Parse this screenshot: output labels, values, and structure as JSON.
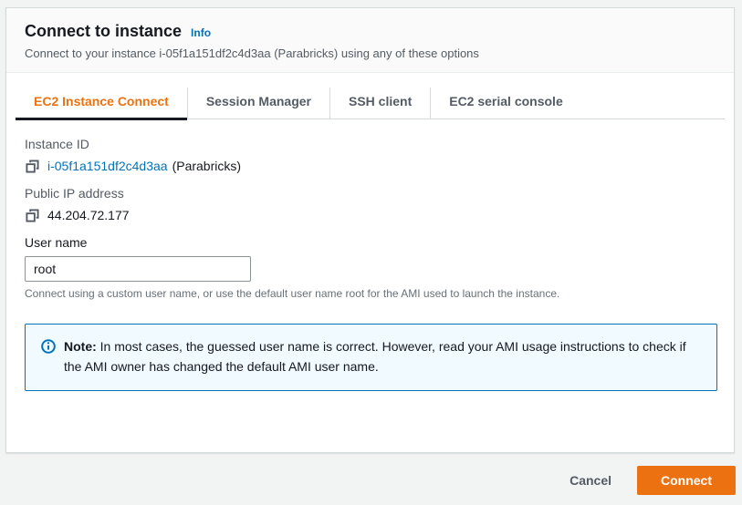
{
  "header": {
    "title": "Connect to instance",
    "info_label": "Info",
    "subtitle": "Connect to your instance i-05f1a151df2c4d3aa (Parabricks) using any of these options"
  },
  "tabs": [
    {
      "label": "EC2 Instance Connect",
      "active": true
    },
    {
      "label": "Session Manager",
      "active": false
    },
    {
      "label": "SSH client",
      "active": false
    },
    {
      "label": "EC2 serial console",
      "active": false
    }
  ],
  "content": {
    "instance_id": {
      "label": "Instance ID",
      "value": "i-05f1a151df2c4d3aa",
      "suffix": " (Parabricks)",
      "copy_icon": "copy-icon"
    },
    "public_ip": {
      "label": "Public IP address",
      "value": "44.204.72.177",
      "copy_icon": "copy-icon"
    },
    "user_name": {
      "label": "User name",
      "value": "root",
      "help": "Connect using a custom user name, or use the default user name root for the AMI used to launch the instance."
    },
    "note": {
      "icon": "info-circle-icon",
      "prefix": "Note:",
      "text": " In most cases, the guessed user name is correct. However, read your AMI usage instructions to check if the AMI owner has changed the default AMI user name."
    }
  },
  "footer": {
    "cancel_label": "Cancel",
    "connect_label": "Connect"
  },
  "colors": {
    "accent_orange": "#ec7211",
    "link_blue": "#0073bb",
    "text_dark": "#16191f",
    "text_gray": "#545b64",
    "help_gray": "#687078",
    "note_background": "#f1faff",
    "note_border": "#0073bb",
    "page_background": "#f2f3f3",
    "card_border": "#d5dbdb",
    "active_tab_underline": "#16191f"
  }
}
